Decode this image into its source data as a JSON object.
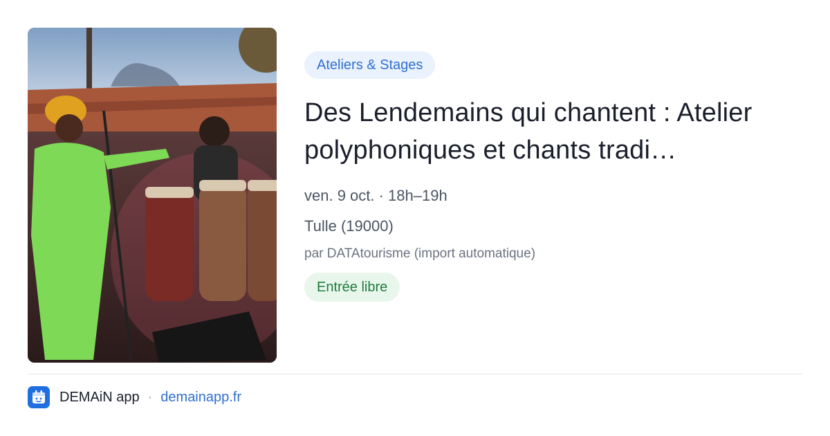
{
  "event": {
    "category": "Ateliers & Stages",
    "title": "Des Lendemains qui chantent : Atelier polyphoniques et chants tradi…",
    "datetime": "ven. 9 oct. · 18h–19h",
    "location": "Tulle (19000)",
    "source": "par DATAtourisme (import automatique)",
    "price": "Entrée libre"
  },
  "footer": {
    "app_name": "DEMAiN app",
    "separator": "·",
    "url": "demainapp.fr",
    "icon": "calendar-app-icon"
  },
  "colors": {
    "category_bg": "#eaf2fd",
    "category_text": "#2f6fd1",
    "price_bg": "#e8f6ec",
    "price_text": "#1f7a3d",
    "accent": "#1f6fe0"
  }
}
